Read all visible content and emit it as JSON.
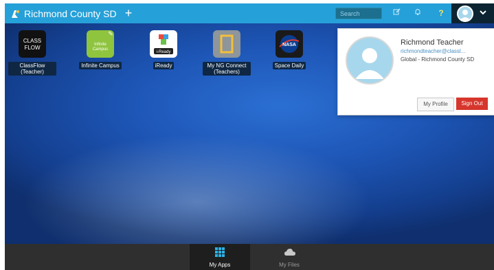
{
  "topbar": {
    "title": "Richmond County SD",
    "add_label": "+",
    "search_placeholder": "Search"
  },
  "apps": [
    {
      "label": "ClassFlow (Teacher)",
      "tile_text": "CLASS FLOW",
      "icon": "classflow-icon"
    },
    {
      "label": "Infinite Campus",
      "tile_text": "Infinite Campus",
      "icon": "infinite-campus-icon"
    },
    {
      "label": "iReady",
      "tile_text": "i-Ready",
      "icon": "iready-icon"
    },
    {
      "label": "My NG Connect (Teachers)",
      "tile_text": "",
      "icon": "ng-connect-icon"
    },
    {
      "label": "Space Daily",
      "tile_text": "NASA",
      "icon": "nasa-icon"
    }
  ],
  "profile_popup": {
    "name": "Richmond Teacher",
    "email": "richmondteacher@classl...",
    "org": "Global - Richmond County SD",
    "my_profile_label": "My Profile",
    "sign_out_label": "Sign Out"
  },
  "bottom_tabs": [
    {
      "label": "My Apps",
      "active": true
    },
    {
      "label": "My Files",
      "active": false
    }
  ],
  "colors": {
    "topbar": "#26a0d8",
    "sign_out": "#d6362c",
    "desktop_blue": "#1d55b5"
  }
}
